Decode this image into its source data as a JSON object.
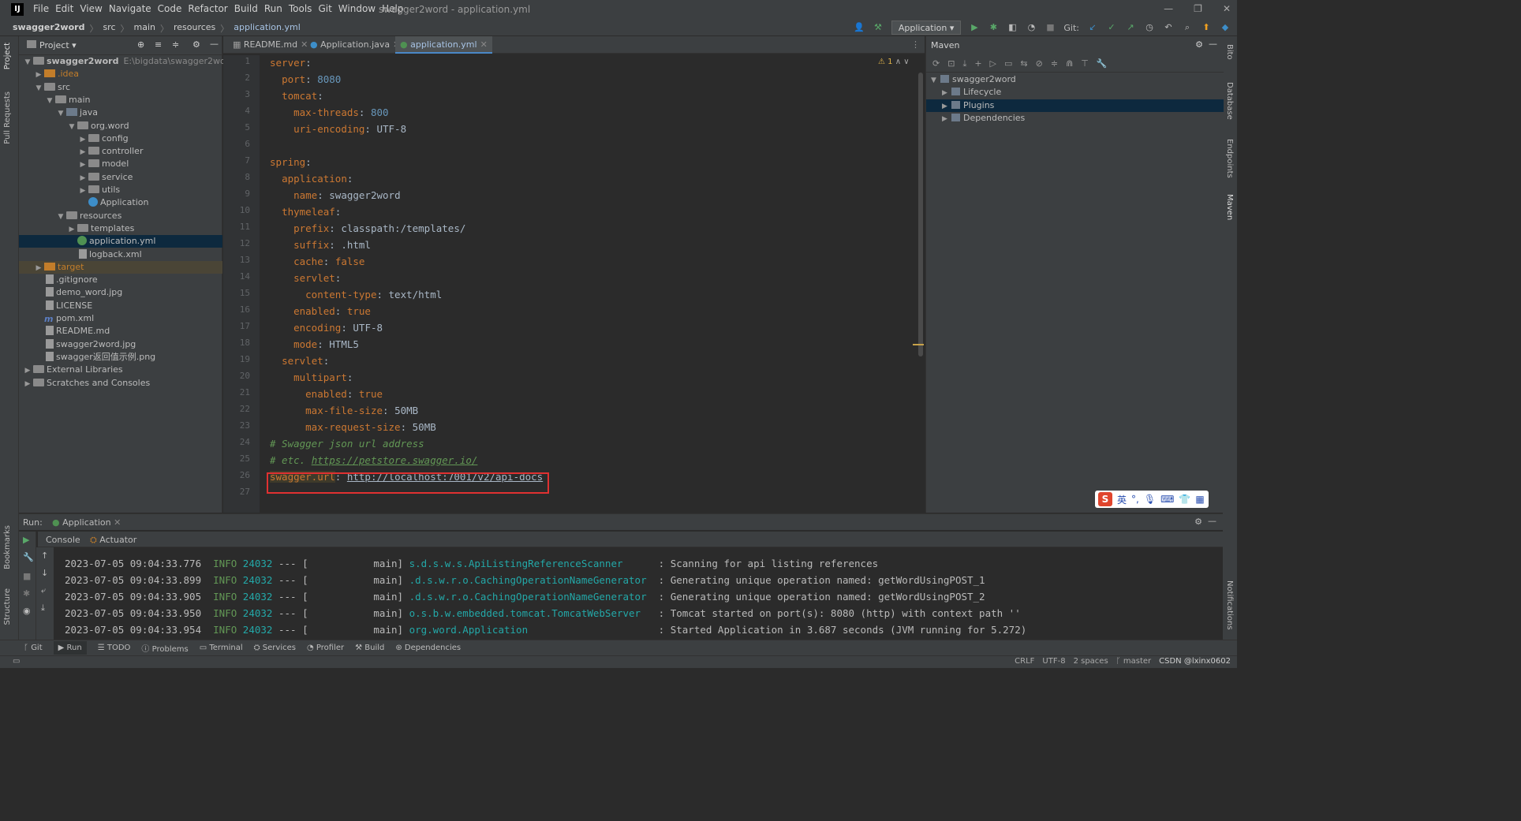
{
  "window": {
    "title": "swagger2word - application.yml",
    "menu": [
      "File",
      "Edit",
      "View",
      "Navigate",
      "Code",
      "Refactor",
      "Build",
      "Run",
      "Tools",
      "Git",
      "Window",
      "Help"
    ],
    "controls": [
      "—",
      "❐",
      "✕"
    ]
  },
  "breadcrumb": [
    "swagger2word",
    "src",
    "main",
    "resources",
    "application.yml"
  ],
  "toolbar": {
    "run_config": "Application",
    "git_label": "Git:"
  },
  "left_strip": {
    "project": "Project",
    "pull_requests": "Pull Requests",
    "bookmarks": "Bookmarks",
    "structure": "Structure"
  },
  "right_strip": {
    "bito": "Bito",
    "database": "Database",
    "endpoints": "Endpoints",
    "maven": "Maven",
    "notifications": "Notifications"
  },
  "project": {
    "header": "Project",
    "tree": [
      {
        "label": "swagger2word",
        "extra": "E:\\bigdata\\swagger2word",
        "indent": 0,
        "arrow": "down",
        "icon": "folder",
        "bold": true
      },
      {
        "label": ".idea",
        "indent": 1,
        "arrow": "right",
        "icon": "folder-o"
      },
      {
        "label": "src",
        "indent": 1,
        "arrow": "down",
        "icon": "folder"
      },
      {
        "label": "main",
        "indent": 2,
        "arrow": "down",
        "icon": "folder"
      },
      {
        "label": "java",
        "indent": 3,
        "arrow": "down",
        "icon": "folder-src"
      },
      {
        "label": "org.word",
        "indent": 4,
        "arrow": "down",
        "icon": "folder"
      },
      {
        "label": "config",
        "indent": 5,
        "arrow": "right",
        "icon": "folder"
      },
      {
        "label": "controller",
        "indent": 5,
        "arrow": "right",
        "icon": "folder"
      },
      {
        "label": "model",
        "indent": 5,
        "arrow": "right",
        "icon": "folder"
      },
      {
        "label": "service",
        "indent": 5,
        "arrow": "right",
        "icon": "folder"
      },
      {
        "label": "utils",
        "indent": 5,
        "arrow": "right",
        "icon": "folder"
      },
      {
        "label": "Application",
        "indent": 5,
        "arrow": "",
        "icon": "java-c"
      },
      {
        "label": "resources",
        "indent": 3,
        "arrow": "down",
        "icon": "folder"
      },
      {
        "label": "templates",
        "indent": 4,
        "arrow": "right",
        "icon": "folder"
      },
      {
        "label": "application.yml",
        "indent": 4,
        "arrow": "",
        "icon": "yml",
        "selected": true
      },
      {
        "label": "logback.xml",
        "indent": 4,
        "arrow": "",
        "icon": "file"
      },
      {
        "label": "target",
        "indent": 1,
        "arrow": "right",
        "icon": "folder-o",
        "target": true
      },
      {
        "label": ".gitignore",
        "indent": 1,
        "arrow": "",
        "icon": "file"
      },
      {
        "label": "demo_word.jpg",
        "indent": 1,
        "arrow": "",
        "icon": "file"
      },
      {
        "label": "LICENSE",
        "indent": 1,
        "arrow": "",
        "icon": "file"
      },
      {
        "label": "pom.xml",
        "indent": 1,
        "arrow": "",
        "icon": "mvn"
      },
      {
        "label": "README.md",
        "indent": 1,
        "arrow": "",
        "icon": "file"
      },
      {
        "label": "swagger2word.jpg",
        "indent": 1,
        "arrow": "",
        "icon": "file"
      },
      {
        "label": "swagger返回值示例.png",
        "indent": 1,
        "arrow": "",
        "icon": "file"
      },
      {
        "label": "External Libraries",
        "indent": 0,
        "arrow": "right",
        "icon": "folder"
      },
      {
        "label": "Scratches and Consoles",
        "indent": 0,
        "arrow": "right",
        "icon": "folder"
      }
    ]
  },
  "editor": {
    "tabs": [
      {
        "label": "README.md",
        "active": false
      },
      {
        "label": "Application.java",
        "active": false
      },
      {
        "label": "application.yml",
        "active": true
      }
    ],
    "warnings": "1",
    "lines": [
      "1",
      "2",
      "3",
      "4",
      "5",
      "6",
      "7",
      "8",
      "9",
      "10",
      "11",
      "12",
      "13",
      "14",
      "15",
      "16",
      "17",
      "18",
      "19",
      "20",
      "21",
      "22",
      "23",
      "24",
      "25",
      "26",
      "27"
    ],
    "code": {
      "l1k": "server",
      "l2k": "port",
      "l2v": "8080",
      "l3k": "tomcat",
      "l4k": "max-threads",
      "l4v": "800",
      "l5k": "uri-encoding",
      "l5v": "UTF-8",
      "l7k": "spring",
      "l8k": "application",
      "l9k": "name",
      "l9v": "swagger2word",
      "l10k": "thymeleaf",
      "l11k": "prefix",
      "l11v": "classpath:/templates/",
      "l12k": "suffix",
      "l12v": ".html",
      "l13k": "cache",
      "l13v": "false",
      "l14k": "servlet",
      "l15k": "content-type",
      "l15v": "text/html",
      "l16k": "enabled",
      "l16v": "true",
      "l17k": "encoding",
      "l17v": "UTF-8",
      "l18k": "mode",
      "l18v": "HTML5",
      "l19k": "servlet",
      "l20k": "multipart",
      "l21k": "enabled",
      "l21v": "true",
      "l22k": "max-file-size",
      "l22v": "50MB",
      "l23k": "max-request-size",
      "l23v": "50MB",
      "l24c": "# Swagger json url address",
      "l25c": "# etc. ",
      "l25u": "https://petstore.swagger.io/",
      "l26k": "swagger.url",
      "l26u": "http://localhost:7001/v2/api-docs"
    }
  },
  "maven": {
    "header": "Maven",
    "items": [
      {
        "label": "swagger2word",
        "indent": 0,
        "arrow": "down"
      },
      {
        "label": "Lifecycle",
        "indent": 1,
        "arrow": "right"
      },
      {
        "label": "Plugins",
        "indent": 1,
        "arrow": "right",
        "selected": true
      },
      {
        "label": "Dependencies",
        "indent": 1,
        "arrow": "right"
      }
    ]
  },
  "ime": {
    "logo": "S",
    "lang": "英"
  },
  "run": {
    "label": "Run:",
    "config_tab": "Application",
    "subtabs": [
      "Console",
      "Actuator"
    ],
    "log": [
      {
        "date": "2023-07-05 09:04:33.776",
        "level": "INFO",
        "pid": "24032",
        "sep": "--- [",
        "thread": "main]",
        "logger": "s.d.s.w.s.ApiListingReferenceScanner",
        "msg": ": Scanning for api listing references"
      },
      {
        "date": "2023-07-05 09:04:33.899",
        "level": "INFO",
        "pid": "24032",
        "sep": "--- [",
        "thread": "main]",
        "logger": ".d.s.w.r.o.CachingOperationNameGenerator",
        "msg": ": Generating unique operation named: getWordUsingPOST_1"
      },
      {
        "date": "2023-07-05 09:04:33.905",
        "level": "INFO",
        "pid": "24032",
        "sep": "--- [",
        "thread": "main]",
        "logger": ".d.s.w.r.o.CachingOperationNameGenerator",
        "msg": ": Generating unique operation named: getWordUsingPOST_2"
      },
      {
        "date": "2023-07-05 09:04:33.950",
        "level": "INFO",
        "pid": "24032",
        "sep": "--- [",
        "thread": "main]",
        "logger": "o.s.b.w.embedded.tomcat.TomcatWebServer",
        "msg": ": Tomcat started on port(s): 8080 (http) with context path ''"
      },
      {
        "date": "2023-07-05 09:04:33.954",
        "level": "INFO",
        "pid": "24032",
        "sep": "--- [",
        "thread": "main]",
        "logger": "org.word.Application",
        "msg": ": Started Application in 3.687 seconds (JVM running for 5.272)"
      }
    ]
  },
  "bottom_tabs": [
    "Git",
    "Run",
    "TODO",
    "Problems",
    "Terminal",
    "Services",
    "Profiler",
    "Build",
    "Dependencies"
  ],
  "status": {
    "line_sep": "CRLF",
    "encoding": "UTF-8",
    "indent": "2 spaces",
    "branch": "master",
    "watermark": "CSDN @lxinx0602"
  }
}
